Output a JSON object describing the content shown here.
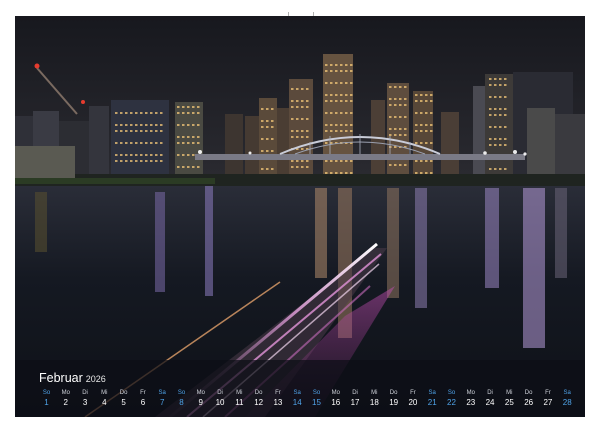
{
  "calendar": {
    "month": "Februar",
    "year": "2026",
    "days": [
      {
        "n": "So",
        "d": "1",
        "we": true
      },
      {
        "n": "Mo",
        "d": "2",
        "we": false
      },
      {
        "n": "Di",
        "d": "3",
        "we": false
      },
      {
        "n": "Mi",
        "d": "4",
        "we": false
      },
      {
        "n": "Do",
        "d": "5",
        "we": false
      },
      {
        "n": "Fr",
        "d": "6",
        "we": false
      },
      {
        "n": "Sa",
        "d": "7",
        "we": true
      },
      {
        "n": "So",
        "d": "8",
        "we": true
      },
      {
        "n": "Mo",
        "d": "9",
        "we": false
      },
      {
        "n": "Di",
        "d": "10",
        "we": false
      },
      {
        "n": "Mi",
        "d": "11",
        "we": false
      },
      {
        "n": "Do",
        "d": "12",
        "we": false
      },
      {
        "n": "Fr",
        "d": "13",
        "we": false
      },
      {
        "n": "Sa",
        "d": "14",
        "we": true
      },
      {
        "n": "So",
        "d": "15",
        "we": true
      },
      {
        "n": "Mo",
        "d": "16",
        "we": false
      },
      {
        "n": "Di",
        "d": "17",
        "we": false
      },
      {
        "n": "Mi",
        "d": "18",
        "we": false
      },
      {
        "n": "Do",
        "d": "19",
        "we": false
      },
      {
        "n": "Fr",
        "d": "20",
        "we": false
      },
      {
        "n": "Sa",
        "d": "21",
        "we": true
      },
      {
        "n": "So",
        "d": "22",
        "we": true
      },
      {
        "n": "Mo",
        "d": "23",
        "we": false
      },
      {
        "n": "Di",
        "d": "24",
        "we": false
      },
      {
        "n": "Mi",
        "d": "25",
        "we": false
      },
      {
        "n": "Do",
        "d": "26",
        "we": false
      },
      {
        "n": "Fr",
        "d": "27",
        "we": false
      },
      {
        "n": "Sa",
        "d": "28",
        "we": true
      }
    ]
  },
  "colors": {
    "weekend": "#4fa3e8",
    "weekday": "#ffffff",
    "sky": "#1c1d24",
    "water": "#0f1319",
    "boat_trail": "#e27bd6"
  },
  "photo": {
    "subject": "night-skyline-river-bridge"
  }
}
